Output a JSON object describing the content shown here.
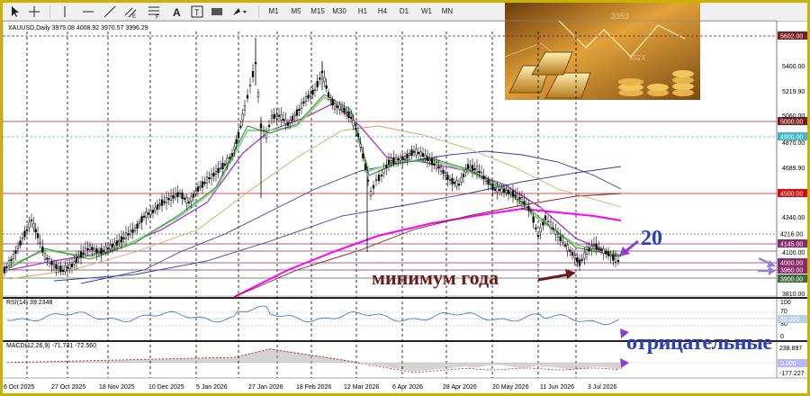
{
  "toolbar": {
    "timeframes": [
      "M1",
      "M5",
      "M15",
      "M30",
      "H1",
      "H4",
      "D1",
      "W1",
      "MN"
    ],
    "icons": [
      "cursor-icon",
      "crosshair-icon",
      "horizontal-line-icon",
      "trendline-icon",
      "equidistant-channel-icon",
      "fibonacci-icon",
      "text-icon",
      "text-label-icon",
      "rectangle-icon",
      "shapes-dropdown-icon"
    ]
  },
  "symbol_line": "XAUUSD,Daily 3975.08 4008.92 3970.57 3996.29",
  "price_axis": {
    "ticks": [
      "5400.00",
      "5219.90",
      "4870.00",
      "4689.90",
      "4340.00",
      "4100.00",
      "3810.00"
    ],
    "labels": [
      {
        "text": "5602.00",
        "color": "#ffffff",
        "bg": "#7a1f1f"
      },
      {
        "text": "5000.00",
        "color": "#ffffff",
        "bg": "#7a1f1f"
      },
      {
        "text": "4900.00",
        "color": "#ffffff",
        "bg": "#3fb7c8"
      },
      {
        "text": "4500.00",
        "color": "#ffffff",
        "bg": "#d01010"
      },
      {
        "text": "4216.00",
        "color": "#000000",
        "bg": "#ffffff"
      },
      {
        "text": "4145.00",
        "color": "#ffffff",
        "bg": "#8a2b6b"
      },
      {
        "text": "4000.00",
        "color": "#ffffff",
        "bg": "#8a2b6b"
      },
      {
        "text": "3960.00",
        "color": "#ffffff",
        "bg": "#8a2b6b"
      },
      {
        "text": "3900.00",
        "color": "#ffffff",
        "bg": "#3d6b3d"
      }
    ],
    "partial": [
      "5060.00"
    ]
  },
  "date_axis": [
    "6 Oct 2025",
    "27 Oct 2025",
    "18 Nov 2025",
    "10 Dec 2025",
    "5 Jan 2026",
    "27 Jan 2026",
    "18 Feb 2026",
    "12 Mar 2026",
    "6 Apr 2026",
    "28 Apr 2026",
    "20 May 2026",
    "11 Jun 2026",
    "3 Jul 2026"
  ],
  "annotations": {
    "year_low": "минимум года",
    "twenty": "20",
    "negative": "отрицательные"
  },
  "rsi": {
    "label": "RSI(14) 39.2348",
    "levels": [
      "100",
      "70",
      "50.000",
      "30",
      "0"
    ]
  },
  "macd": {
    "label": "MACD(12,26,9) -71.731 -72.560",
    "levels": [
      "238.897",
      "0.000",
      "-177.227"
    ]
  },
  "colors": {
    "frame": "#c9b200",
    "annotation_text": "#6b1b1b",
    "blue_annotation": "#2a3fbd",
    "arrow_purple": "#8c3fd0",
    "ma_green": "#2f8f2f",
    "ma_lightgreen": "#8fd48f",
    "ma_violet": "#b040c8",
    "ma_tan": "#d7a45a",
    "ma_blue": "#2f3fa8",
    "ma_magenta": "#ff00ff",
    "ma_darkred": "#8b1a1a"
  }
}
